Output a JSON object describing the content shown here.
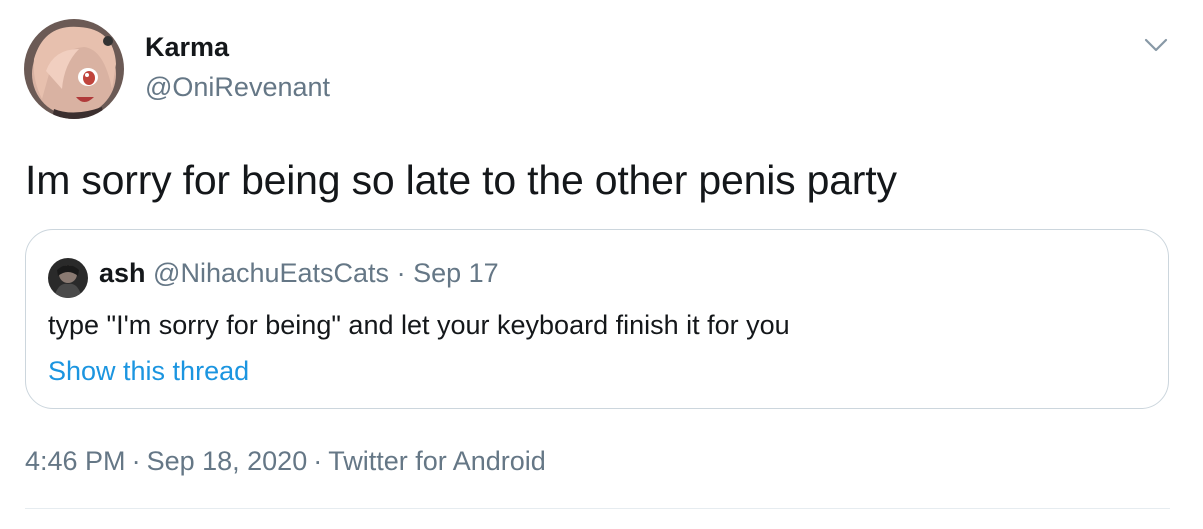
{
  "author": {
    "display_name": "Karma",
    "handle": "@OniRevenant"
  },
  "tweet": {
    "text": "Im sorry for being so late to the other penis party"
  },
  "quoted_tweet": {
    "name": "ash",
    "handle": "@NihachuEatsCats",
    "separator": "·",
    "date": "Sep 17",
    "text": "type \"I'm sorry for being\" and let your keyboard finish it for you",
    "show_thread_label": "Show this thread"
  },
  "meta": {
    "time": "4:46 PM",
    "separator": "·",
    "date": "Sep 18, 2020",
    "separator2": "·",
    "source": "Twitter for Android"
  },
  "icons": {
    "menu": "chevron-down-icon"
  },
  "colors": {
    "link": "#1b95e0",
    "secondary_text": "#657786",
    "border": "#ccd6dd"
  }
}
